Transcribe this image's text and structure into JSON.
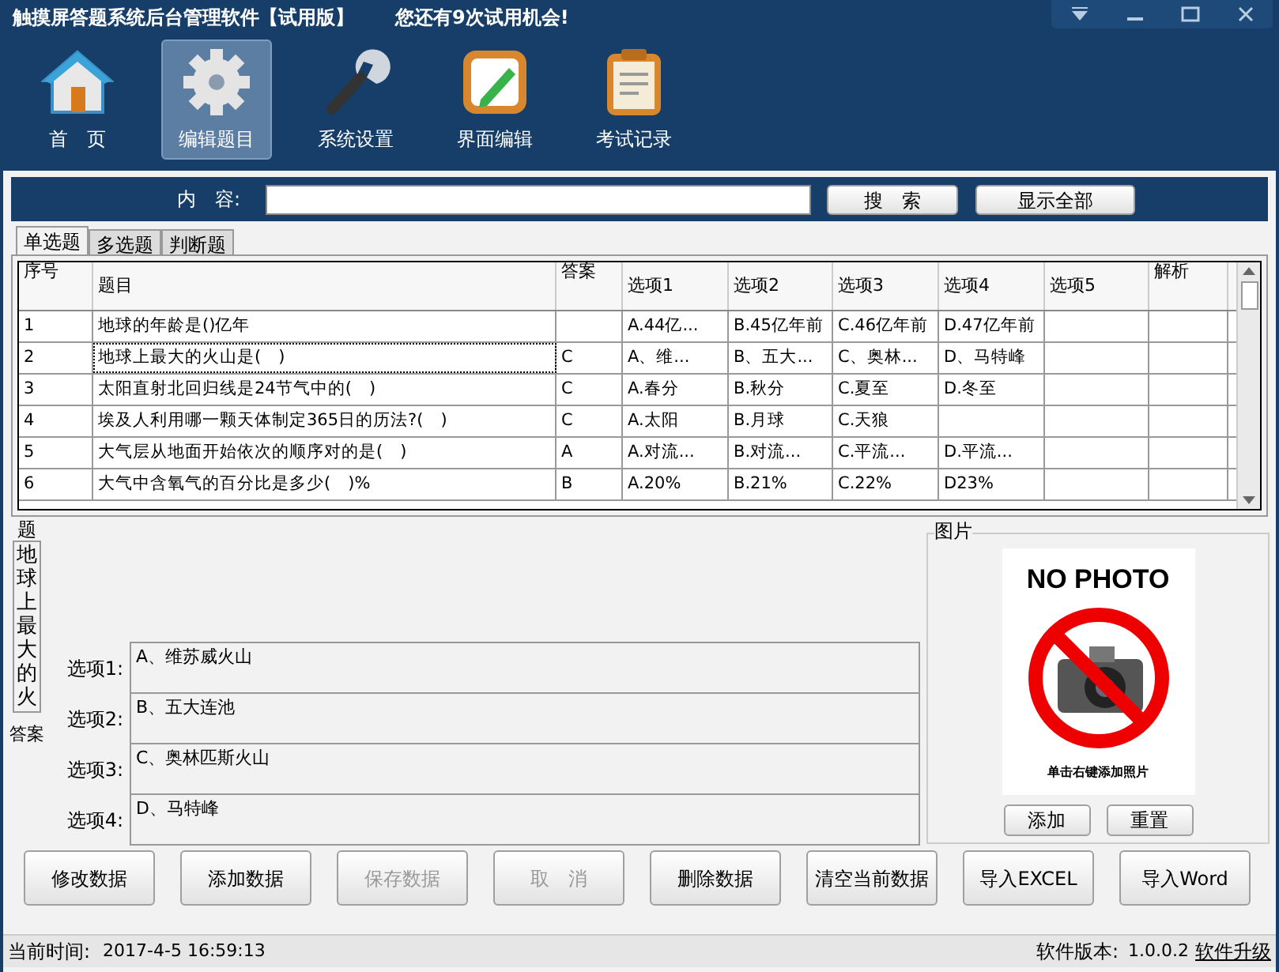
{
  "window": {
    "title": "触摸屏答题系统后台管理软件【试用版】",
    "notice": "您还有9次试用机会!"
  },
  "toolbar": [
    {
      "kind": "home",
      "label": "首　页",
      "selected": false
    },
    {
      "kind": "gear",
      "label": "编辑题目",
      "selected": true
    },
    {
      "kind": "wrench",
      "label": "系统设置",
      "selected": false
    },
    {
      "kind": "pencil",
      "label": "界面编辑",
      "selected": false
    },
    {
      "kind": "clipboard",
      "label": "考试记录",
      "selected": false
    }
  ],
  "search": {
    "label": "内　容:",
    "buttons": [
      "搜　索",
      "显示全部"
    ]
  },
  "tabs": [
    {
      "label": "单选题",
      "selected": true
    },
    {
      "label": "多选题",
      "selected": false
    },
    {
      "label": "判断题",
      "selected": false
    }
  ],
  "table": {
    "columns": [
      "序号",
      "题目",
      "答案",
      "选项1",
      "选项2",
      "选项3",
      "选项4",
      "选项5",
      "解析"
    ],
    "rows": [
      {
        "selected": false,
        "cells": [
          "1",
          "地球的年龄是()亿年",
          "",
          "A.44亿...",
          "B.45亿年前",
          "C.46亿年前",
          "D.47亿年前",
          "",
          ""
        ]
      },
      {
        "selected": true,
        "cells": [
          "2",
          "地球上最大的火山是(　)",
          "C",
          "A、维...",
          "B、五大...",
          "C、奥林...",
          "D、马特峰",
          "",
          ""
        ]
      },
      {
        "selected": false,
        "cells": [
          "3",
          "太阳直射北回归线是24节气中的(　)",
          "C",
          "A.春分",
          "B.秋分",
          "C.夏至",
          "D.冬至",
          "",
          ""
        ]
      },
      {
        "selected": false,
        "cells": [
          "4",
          "埃及人利用哪一颗天体制定365日的历法?(　)",
          "C",
          "A.太阳",
          "B.月球",
          "C.天狼",
          "",
          "",
          ""
        ]
      },
      {
        "selected": false,
        "cells": [
          "5",
          "大气层从地面开始依次的顺序对的是(　)",
          "A",
          "A.对流...",
          "B.对流...",
          "C.平流...",
          "D.平流...",
          "",
          ""
        ]
      },
      {
        "selected": false,
        "cells": [
          "6",
          "大气中含氧气的百分比是多少(　)%",
          "B",
          "A.20%",
          "B.21%",
          "C.22%",
          "D23%",
          "",
          ""
        ]
      }
    ]
  },
  "editor": {
    "question_label": "题",
    "question": "地球上最大的火",
    "answer_label": "答案",
    "options": [
      {
        "label": "选项1:",
        "value": "A、维苏威火山"
      },
      {
        "label": "选项2:",
        "value": "B、五大连池"
      },
      {
        "label": "选项3:",
        "value": "C、奥林匹斯火山"
      },
      {
        "label": "选项4:",
        "value": "D、马特峰"
      }
    ]
  },
  "picture": {
    "label": "图片",
    "heading": "NO PHOTO",
    "hint": "单击右键添加照片",
    "buttons": [
      "添加",
      "重置"
    ]
  },
  "actions": [
    {
      "label": "修改数据",
      "disabled": false
    },
    {
      "label": "添加数据",
      "disabled": false
    },
    {
      "label": "保存数据",
      "disabled": true
    },
    {
      "label": "取　消",
      "disabled": true
    },
    {
      "label": "删除数据",
      "disabled": false
    },
    {
      "label": "清空当前数据",
      "disabled": false
    },
    {
      "label": "导入EXCEL",
      "disabled": false
    },
    {
      "label": "导入Word",
      "disabled": false
    }
  ],
  "status_bar": {
    "time_label": "当前时间:",
    "time": "2017-4-5 16:59:13",
    "version_label": "软件版本:",
    "version": "1.0.0.2",
    "upgrade_link": "软件升级"
  }
}
